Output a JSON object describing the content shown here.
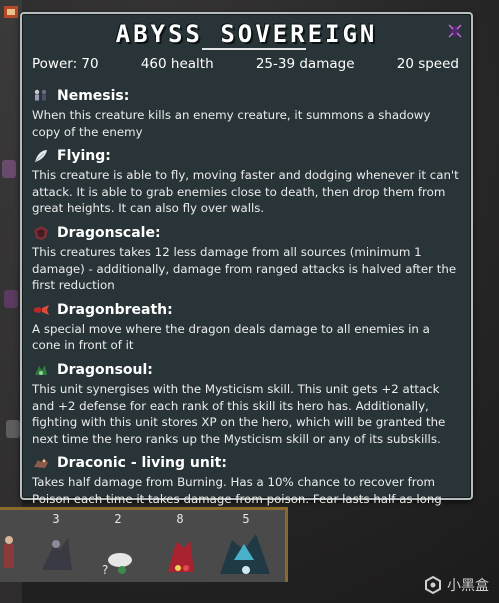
{
  "tooltip": {
    "title": "ABYSS SOVEREIGN",
    "stats": {
      "power": "Power: 70",
      "health": "460 health",
      "damage": "25-39 damage",
      "speed": "20 speed"
    },
    "abilities": [
      {
        "name": "Nemesis:",
        "icon": "shadow-figures-icon",
        "description": "When this creature kills an enemy creature, it summons a shadowy copy of the enemy"
      },
      {
        "name": "Flying:",
        "icon": "feather-icon",
        "description": "This creature is able to fly, moving faster and dodging whenever it can't attack. It is able to grab enemies close to death, then drop them from great heights. It can also fly over walls."
      },
      {
        "name": "Dragonscale:",
        "icon": "dragon-scale-icon",
        "description": "This creatures takes 12 less damage from all sources (minimum 1 damage) - additionally, damage from ranged attacks is halved after the first reduction"
      },
      {
        "name": "Dragonbreath:",
        "icon": "dragon-breath-icon",
        "description": "A special move where the dragon deals damage to all enemies in a cone in front of it"
      },
      {
        "name": "Dragonsoul:",
        "icon": "dragon-soul-icon",
        "description": "This unit synergises with the Mysticism skill. This unit gets +2 attack and +2 defense for each rank of this skill its hero has. Additionally, fighting with this unit stores XP on the hero, which will be granted the next time the hero ranks up the Mysticism skill or any of its subskills."
      },
      {
        "name": "Draconic - living unit:",
        "icon": "draconic-icon",
        "description": "Takes half damage from Burning. Has a 10% chance to recover from Poison each time it takes damage from poison. Fear lasts half as long"
      }
    ]
  },
  "unit_bar": {
    "counts": [
      "3",
      "2",
      "8",
      "5"
    ]
  },
  "watermark": {
    "text": "小黑盒"
  },
  "colors": {
    "tooltip_bg": "#283437",
    "tooltip_border": "#b9bcbc",
    "unit_bar_border": "#8a6a2c"
  }
}
